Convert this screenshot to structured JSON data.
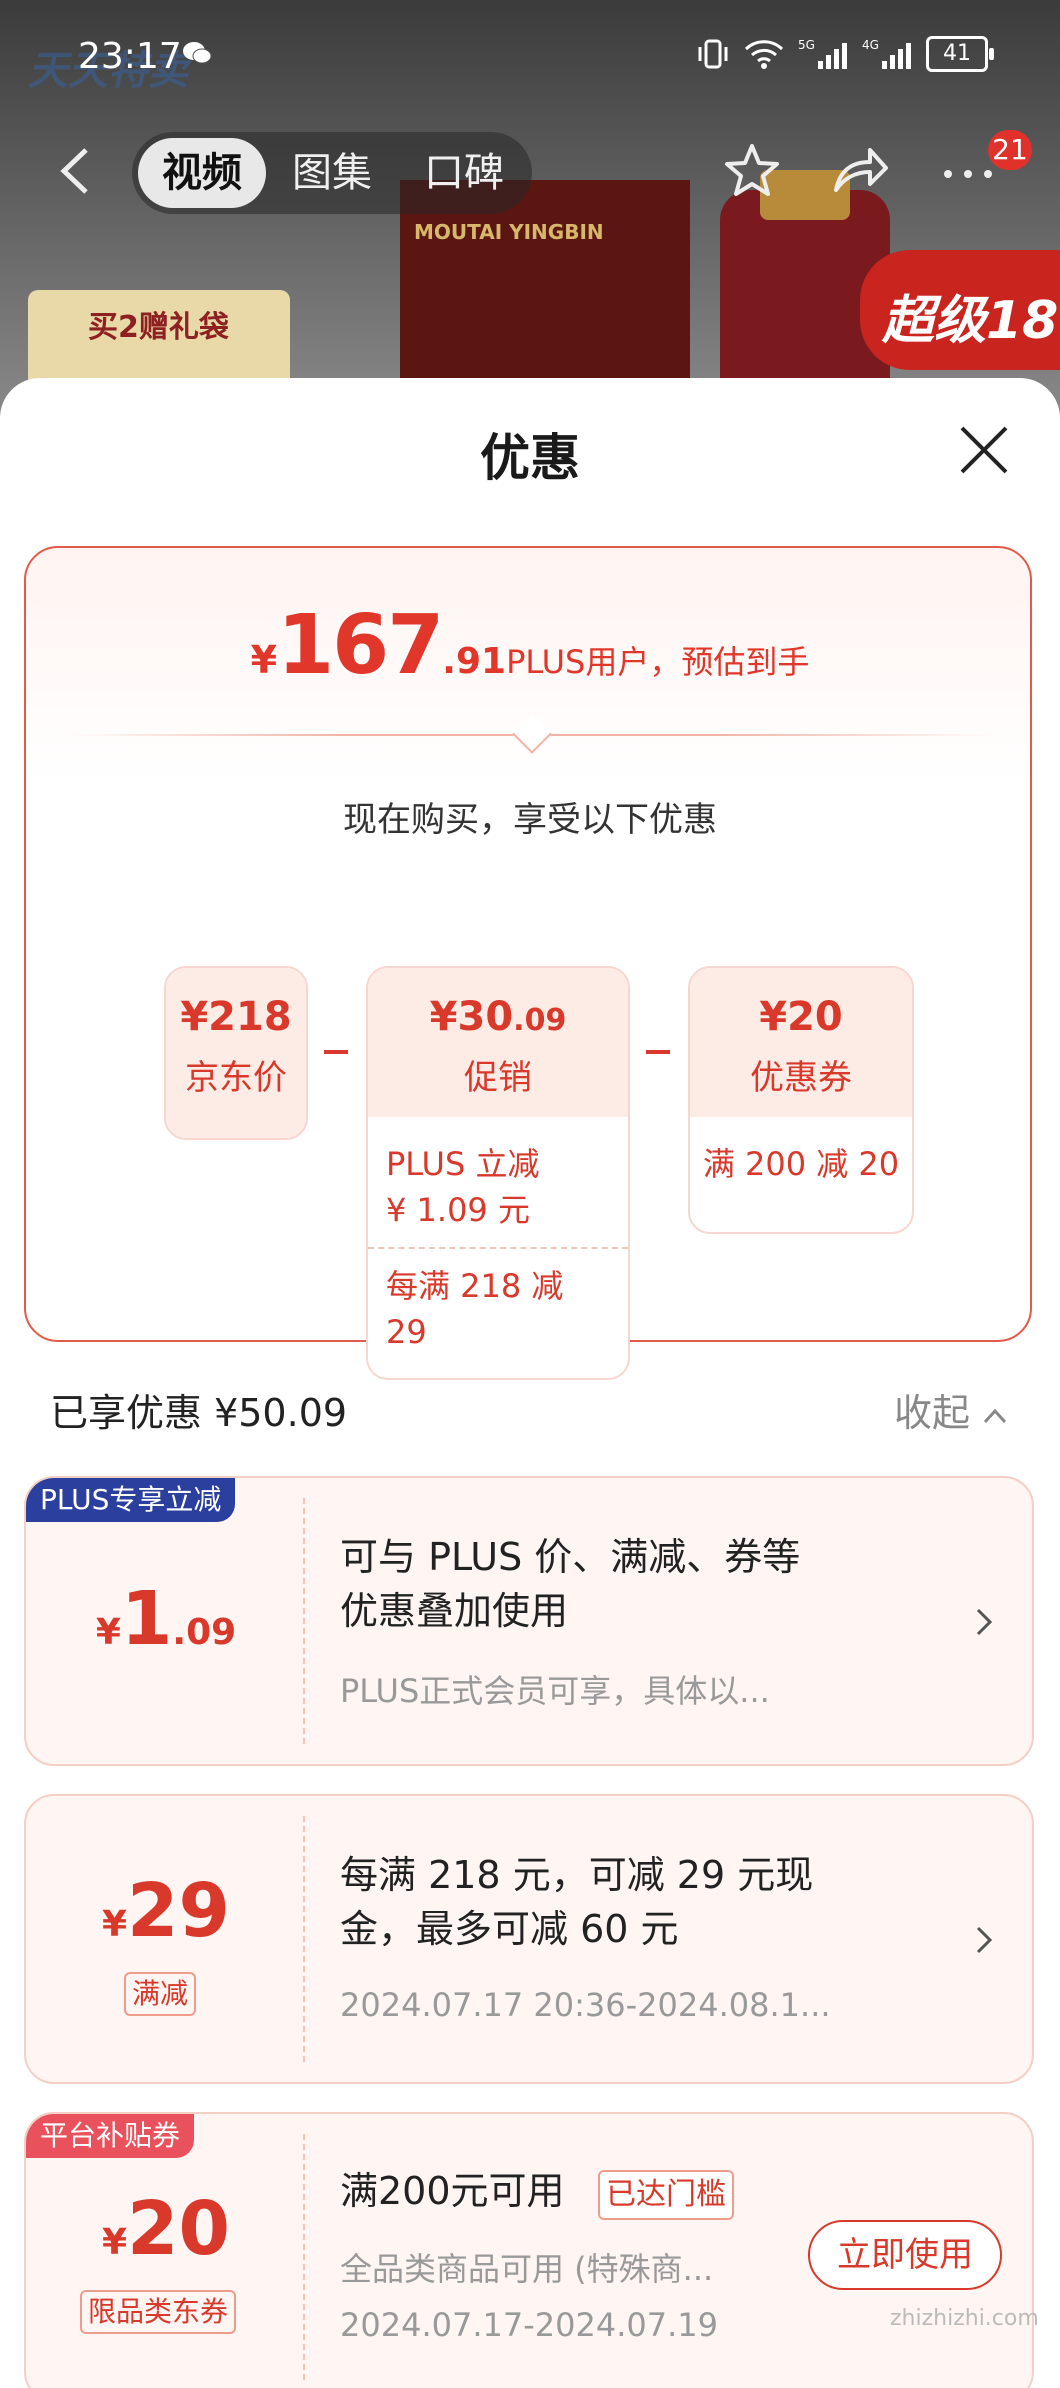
{
  "status_bar": {
    "time": "23:17",
    "network": "5G 4G",
    "battery": "41"
  },
  "nav": {
    "tabs": [
      {
        "label": "视频"
      },
      {
        "label": "图集"
      },
      {
        "label": "口碑"
      }
    ],
    "message_count": "21"
  },
  "background": {
    "gift_label": "买2赠礼袋",
    "box_text": "MOUTAI YINGBIN",
    "promo_text": "超级18"
  },
  "sheet": {
    "title": "优惠",
    "estimate": {
      "symbol": "¥",
      "integer": "167",
      "decimal": ".91",
      "desc": "PLUS用户，预估到手"
    },
    "buy_now_text": "现在购买，享受以下优惠",
    "breakdown": [
      {
        "value_main": "¥218",
        "value_small": "",
        "label": "京东价"
      },
      {
        "value_main": "¥30",
        "value_small": ".09",
        "label": "促销",
        "notes": [
          "PLUS 立减\n¥ 1.09 元"
        ],
        "extra_note": "每满 218 减 29"
      },
      {
        "value_main": "¥20",
        "value_small": "",
        "label": "优惠券",
        "notes": [
          "满 200 减 20"
        ]
      }
    ],
    "enjoyed": "已享优惠 ¥50.09",
    "collapse_label": "收起",
    "cards": [
      {
        "corner_tag": "PLUS专享立减",
        "symbol": "¥",
        "integer": "1",
        "decimal": ".09",
        "main_line1": "可与 PLUS 价、满减、券等",
        "main_line2": "优惠叠加使用",
        "sub": "PLUS正式会员可享，具体以..."
      },
      {
        "symbol": "¥",
        "integer": "29",
        "decimal": "",
        "tag": "满减",
        "main_line1": "每满 218 元，可减 29 元现",
        "main_line2": "金，最多可减 60 元",
        "sub": "2024.07.17 20:36-2024.08.1..."
      },
      {
        "corner_tag": "平台补贴券",
        "symbol": "¥",
        "integer": "20",
        "decimal": "",
        "tag": "限品类东券",
        "main_line1": "满200元可用",
        "threshold_badge": "已达门槛",
        "main_line2": "全品类商品可用 (特殊商...",
        "sub": "2024.07.17-2024.07.19",
        "button": "立即使用"
      }
    ]
  },
  "watermark": "zhizhizhi.com",
  "colors": {
    "accent": "#d8392b",
    "plus_blue": "#2b3f9e",
    "subsidy_pink": "#e9525c"
  }
}
